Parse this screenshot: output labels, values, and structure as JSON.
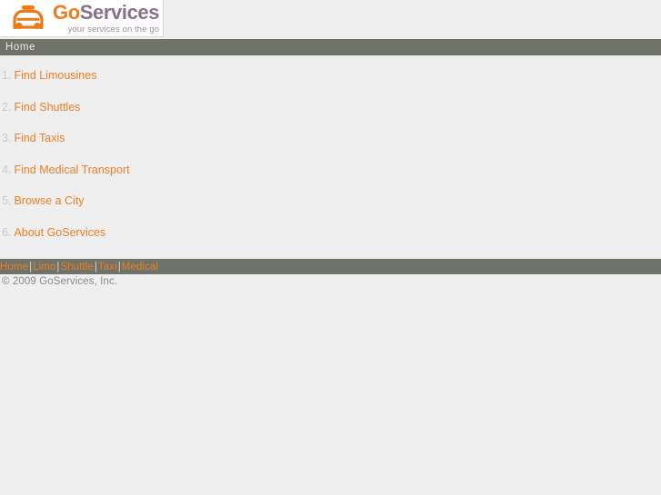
{
  "brand": {
    "icon": "taxi-icon",
    "name_part_go": "Go",
    "name_part_services": "Services",
    "tagline": "your services on the go",
    "color_orange": "#ee7d1e",
    "color_purple_gray": "#837487"
  },
  "breadcrumb": {
    "items": [
      {
        "label": "Home"
      }
    ]
  },
  "main": {
    "items": [
      {
        "number": "1.",
        "label": "Find Limousines"
      },
      {
        "number": "2.",
        "label": "Find Shuttles"
      },
      {
        "number": "3.",
        "label": "Find Taxis"
      },
      {
        "number": "4.",
        "label": "Find Medical Transport"
      },
      {
        "number": "5.",
        "label": "Browse a City"
      },
      {
        "number": "6.",
        "label": "About GoServices"
      }
    ]
  },
  "footer": {
    "separator": "|",
    "links": [
      {
        "label": "Home"
      },
      {
        "label": "Limo"
      },
      {
        "label": "Shuttle"
      },
      {
        "label": "Taxi"
      },
      {
        "label": "Medical"
      }
    ],
    "copyright": "© 2009 GoServices, Inc.",
    "bar_color": "#6f7369",
    "link_color": "#ee7d1e"
  }
}
